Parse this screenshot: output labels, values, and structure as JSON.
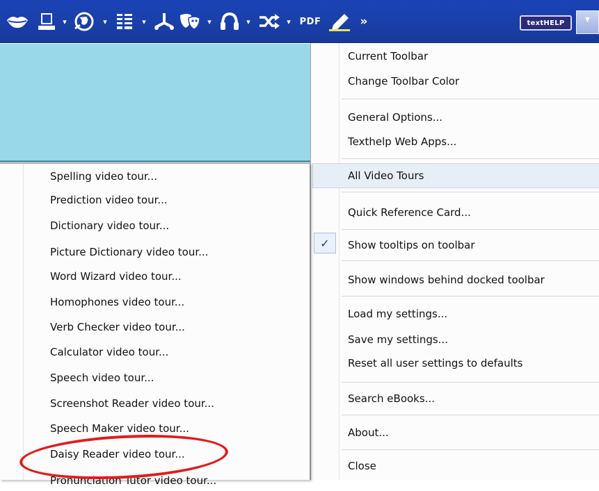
{
  "toolbar": {
    "icons": [
      "lips-icon",
      "monitor-icon",
      "globe-icon",
      "document-icon",
      "fork-icon",
      "drama-masks-icon",
      "headphones-icon",
      "shuffle-icon",
      "pdf-icon",
      "highlighter-icon"
    ],
    "dropdown_arrow": "▾",
    "pdf_label": "PDF",
    "more_label": "»",
    "brand_label": "textHELP",
    "menu_button_arrow": "▾",
    "color": "#1b43b6"
  },
  "main_menu": {
    "items": [
      {
        "label": "Current Toolbar"
      },
      {
        "label": "Change Toolbar Color"
      },
      {
        "label": "General Options..."
      },
      {
        "label": "Texthelp Web Apps..."
      },
      {
        "label": "All Video Tours"
      },
      {
        "label": "Quick Reference Card..."
      },
      {
        "label": "Show tooltips on toolbar"
      },
      {
        "label": "Show windows behind docked toolbar"
      },
      {
        "label": "Load my settings..."
      },
      {
        "label": "Save my settings..."
      },
      {
        "label": "Reset all user settings to defaults"
      },
      {
        "label": "Search eBooks..."
      },
      {
        "label": "About..."
      },
      {
        "label": "Close"
      }
    ],
    "check_mark": "✓"
  },
  "submenu": {
    "items": [
      {
        "label": "Spelling video tour..."
      },
      {
        "label": "Prediction video tour..."
      },
      {
        "label": "Dictionary video tour..."
      },
      {
        "label": "Picture Dictionary video tour..."
      },
      {
        "label": "Word Wizard video tour..."
      },
      {
        "label": "Homophones video tour..."
      },
      {
        "label": "Verb Checker video tour..."
      },
      {
        "label": "Calculator video tour..."
      },
      {
        "label": "Speech video tour..."
      },
      {
        "label": "Screenshot Reader video tour..."
      },
      {
        "label": "Speech Maker video tour..."
      },
      {
        "label": "Daisy Reader video tour..."
      },
      {
        "label": "Pronunciation Tutor video tour..."
      }
    ]
  },
  "annotation": {
    "color": "#e01c1c",
    "highlighted_item": "Daisy Reader video tour..."
  }
}
